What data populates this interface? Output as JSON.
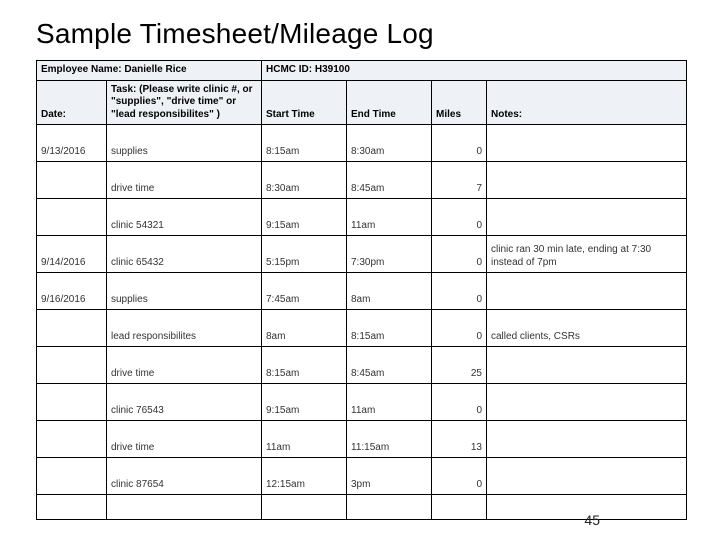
{
  "title": "Sample Timesheet/Mileage Log",
  "header": {
    "employee_name_label": "Employee Name: Danielle Rice",
    "hcmc_id_label": "HCMC ID: H39100"
  },
  "columns": {
    "date": "Date:",
    "task": "Task: (Please write clinic #, or \"supplies\", \"drive time\" or \"lead responsibilites\" )",
    "start": "Start Time",
    "end": "End Time",
    "miles": "Miles",
    "notes": "Notes:"
  },
  "rows": [
    {
      "date": "9/13/2016",
      "task": "supplies",
      "start": "8:15am",
      "end": "8:30am",
      "miles": "0",
      "notes": ""
    },
    {
      "date": "",
      "task": "drive time",
      "start": "8:30am",
      "end": "8:45am",
      "miles": "7",
      "notes": ""
    },
    {
      "date": "",
      "task": "clinic 54321",
      "start": "9:15am",
      "end": "11am",
      "miles": "0",
      "notes": ""
    },
    {
      "date": "9/14/2016",
      "task": "clinic 65432",
      "start": "5:15pm",
      "end": "7:30pm",
      "miles": "0",
      "notes": "clinic ran 30 min late, ending at 7:30 instead of 7pm"
    },
    {
      "date": "9/16/2016",
      "task": "supplies",
      "start": "7:45am",
      "end": "8am",
      "miles": "0",
      "notes": ""
    },
    {
      "date": "",
      "task": "lead responsibilites",
      "start": "8am",
      "end": "8:15am",
      "miles": "0",
      "notes": "called clients, CSRs"
    },
    {
      "date": "",
      "task": "drive time",
      "start": "8:15am",
      "end": "8:45am",
      "miles": "25",
      "notes": ""
    },
    {
      "date": "",
      "task": "clinic 76543",
      "start": "9:15am",
      "end": "11am",
      "miles": "0",
      "notes": ""
    },
    {
      "date": "",
      "task": "drive time",
      "start": "11am",
      "end": "11:15am",
      "miles": "13",
      "notes": ""
    },
    {
      "date": "",
      "task": "clinic 87654",
      "start": "12:15am",
      "end": "3pm",
      "miles": "0",
      "notes": ""
    }
  ],
  "page_number": "45"
}
